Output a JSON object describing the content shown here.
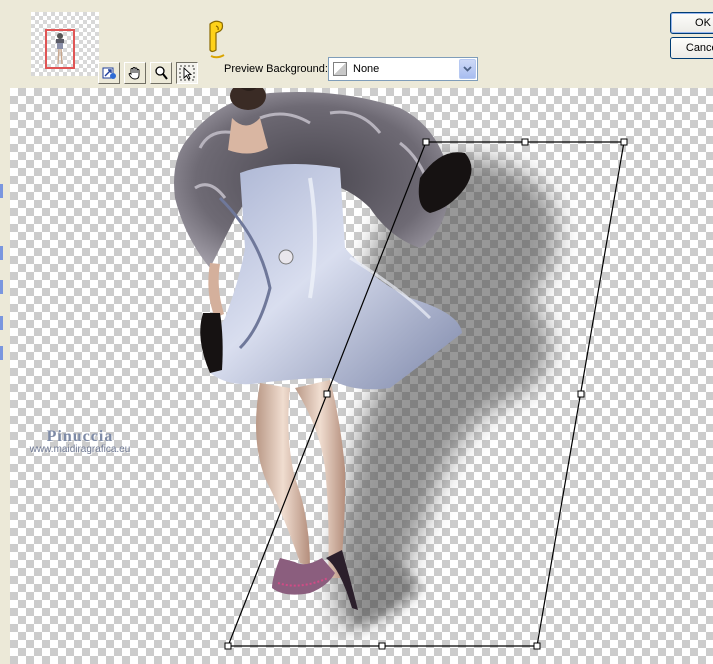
{
  "toolbar": {
    "preview_background_label": "Preview Background:",
    "preview_background_value": "None",
    "tools": [
      "reset-icon",
      "pan-hand-icon",
      "zoom-icon",
      "pick-arrow-icon"
    ],
    "active_tool": "pick-arrow-icon"
  },
  "dialog_buttons": {
    "ok_label": "OK",
    "cancel_label": "Cancel"
  },
  "watermark": {
    "name": "Pinuccia",
    "url": "www.maidiragrafica.eu"
  },
  "colors": {
    "dialog_face": "#ece9d8",
    "button_border": "#003c74",
    "dropdown_border": "#7f9db9",
    "thumbnail_frame": "#e05555"
  }
}
